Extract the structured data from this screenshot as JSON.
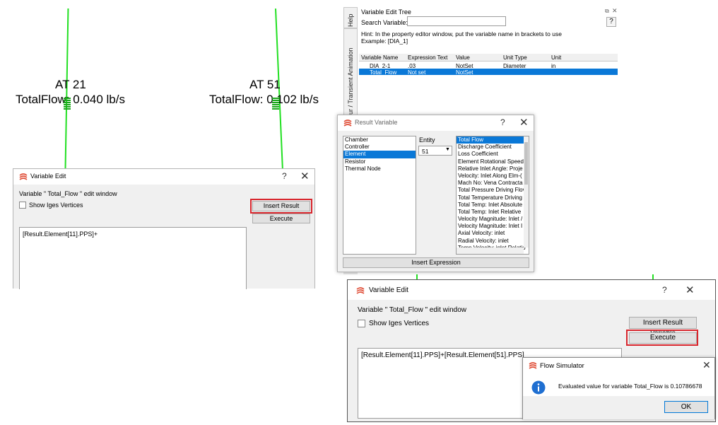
{
  "canvas": {
    "node_left": {
      "at_label": "AT  21",
      "flow_label": "TotalFlow: 0.040 lb/s"
    },
    "node_right": {
      "at_label": "AT  51",
      "flow_label": "TotalFlow: 0.102 lb/s"
    }
  },
  "variable_edit_1": {
    "title": "Variable Edit",
    "help": "?",
    "close": "✕",
    "caption": "Variable \" Total_Flow \" edit window",
    "show_iges": "Show Iges Vertices",
    "insert_btn": "Insert Result Variable",
    "execute_btn": "Execute",
    "expression": "[Result.Element[11].PPS]+"
  },
  "tree": {
    "title": "Variable Edit Tree",
    "search_label": "Search Variable:",
    "search_value": "",
    "hint_line1": "Hint: In the property editor window, put the variable name in brackets to use",
    "hint_line2": "Example: [DIA_1]",
    "side_tabs": [
      "Help",
      "Contour / Transient Animation"
    ],
    "question": "?",
    "columns": [
      "Variable Name",
      "Expression Text",
      "Value",
      "Unit Type",
      "Unit"
    ],
    "rows": [
      {
        "name": "DIA_2-1",
        "expr": ".03",
        "value": "NotSet",
        "unit_type": "Diameter",
        "unit": "in"
      },
      {
        "name": "Total_Flow",
        "expr": "Not set",
        "value": "NotSet",
        "unit_type": "",
        "unit": ""
      }
    ]
  },
  "result_variable": {
    "title": "Result Variable",
    "help": "?",
    "close": "✕",
    "categories": [
      "Chamber",
      "Controller",
      "Element",
      "Resistor",
      "Thermal Node"
    ],
    "selected_category": "Element",
    "entity_label": "Entity",
    "entity_value": "51",
    "properties": [
      "Total Flow",
      "Discharge Coefficient",
      "Loss Coefficient",
      "Element Rotational Speed",
      "Relative Inlet Angle: Proje",
      "Velocity: Inlet Along Elm-(",
      "Mach No: Vena Contracta",
      "Total Pressure Driving Flov",
      "Total Temperature Driving",
      "Total Temp: Inlet Absolute",
      "Total Temp: Inlet Relative",
      "Velocity Magnitude: Inlet /",
      "Velocity Magnitude: Inlet I",
      "Axial Velocity: inlet",
      "Radial Velocity: inlet",
      "Temp Velocity: inlet Relatio"
    ],
    "selected_property": "Total Flow",
    "insert_btn": "Insert Expression"
  },
  "variable_edit_2": {
    "title": "Variable Edit",
    "help": "?",
    "close": "✕",
    "caption": "Variable \" Total_Flow \" edit window",
    "show_iges": "Show Iges Vertices",
    "insert_btn": "Insert Result Variable",
    "execute_btn": "Execute",
    "expression": "[Result.Element[11].PPS]+[Result.Element[51].PPS]"
  },
  "flow_sim": {
    "title": "Flow Simulator",
    "close": "✕",
    "message": "Evaluated value for variable Total_Flow is 0.10786678",
    "ok": "OK"
  },
  "colors": {
    "green_line": "#22e022",
    "highlight": "#d8252c",
    "selection": "#0a78d7",
    "info_icon": "#1f6fd1"
  }
}
